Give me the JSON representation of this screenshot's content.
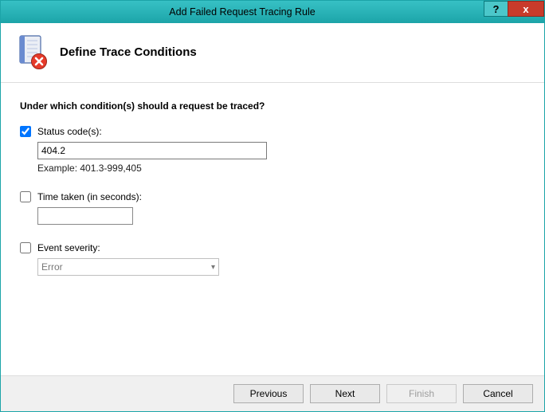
{
  "window": {
    "title": "Add Failed Request Tracing Rule",
    "help_glyph": "?",
    "close_glyph": "x"
  },
  "header": {
    "title": "Define Trace Conditions"
  },
  "content": {
    "question": "Under which condition(s) should a request be traced?",
    "status_codes": {
      "label": "Status code(s):",
      "checked": true,
      "value": "404.2",
      "example": "Example: 401.3-999,405"
    },
    "time_taken": {
      "label": "Time taken (in seconds):",
      "checked": false,
      "value": ""
    },
    "event_severity": {
      "label": "Event severity:",
      "checked": false,
      "selected": "Error"
    }
  },
  "footer": {
    "previous": "Previous",
    "next": "Next",
    "finish": "Finish",
    "cancel": "Cancel"
  }
}
